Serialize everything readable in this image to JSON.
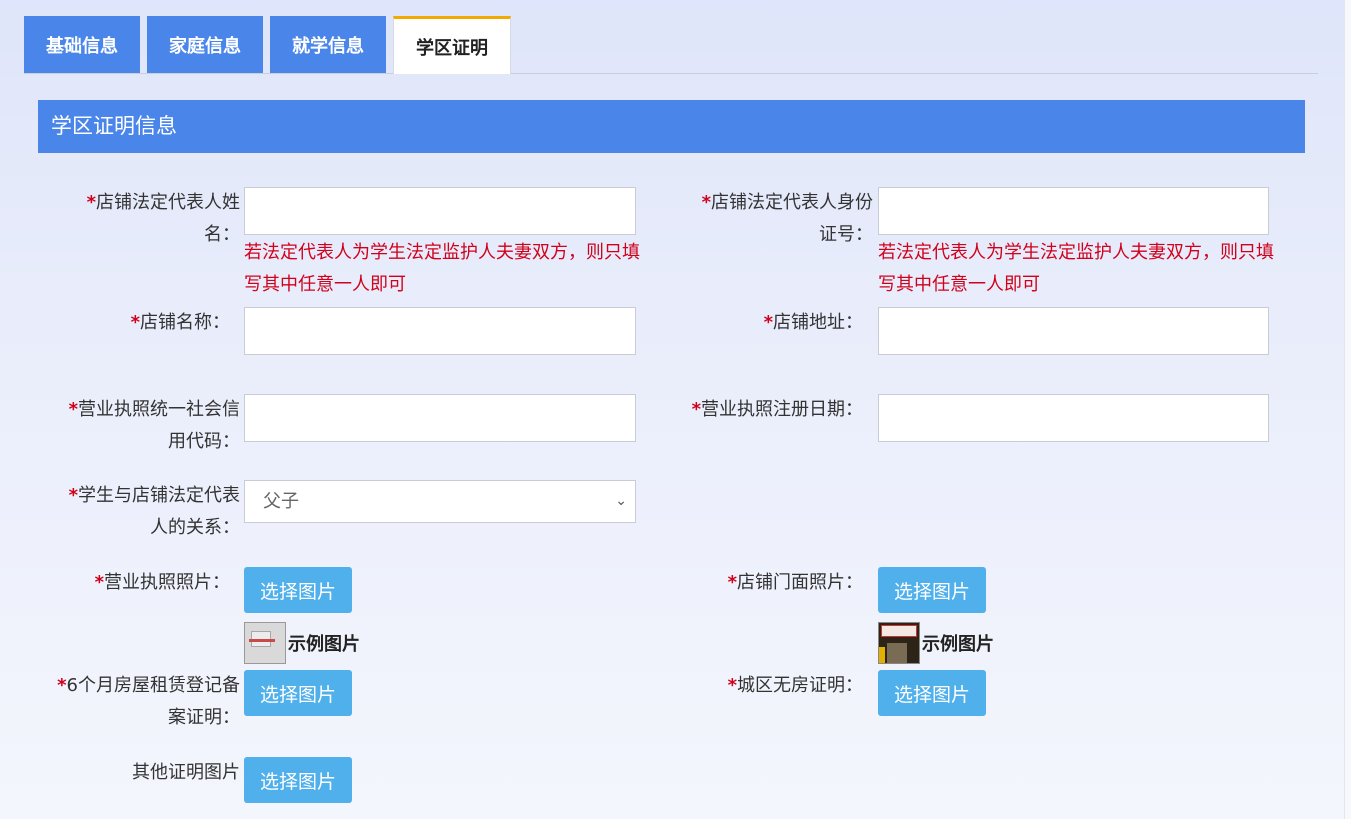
{
  "tabs": [
    {
      "label": "基础信息",
      "active": false
    },
    {
      "label": "家庭信息",
      "active": false
    },
    {
      "label": "就学信息",
      "active": false
    },
    {
      "label": "学区证明",
      "active": true
    }
  ],
  "section": {
    "title": "学区证明信息"
  },
  "form": {
    "required_mark": "*",
    "rep_name": {
      "label_l1": "店铺法定代表人姓",
      "label_l2": "名：",
      "value": ""
    },
    "rep_id": {
      "label_l1": "店铺法定代表人身份",
      "label_l2": "证号：",
      "value": ""
    },
    "hint_l1": "若法定代表人为学生法定监护人夫妻双方，则只填",
    "hint_l2": "写其中任意一人即可",
    "shop_name": {
      "label": "店铺名称：",
      "value": ""
    },
    "shop_address": {
      "label": "店铺地址：",
      "value": ""
    },
    "credit_code": {
      "label_l1": "营业执照统一社会信",
      "label_l2": "用代码：",
      "value": ""
    },
    "reg_date": {
      "label": "营业执照注册日期：",
      "value": ""
    },
    "relation": {
      "label_l1": "学生与店铺法定代表",
      "label_l2": "人的关系：",
      "selected": "父子"
    },
    "license_photo": {
      "label": "营业执照照片："
    },
    "storefront_photo": {
      "label": "店铺门面照片："
    },
    "rental_cert": {
      "label_l1": "6个月房屋租赁登记备",
      "label_l2": "案证明："
    },
    "no_house_cert": {
      "label": "城区无房证明："
    },
    "other_cert": {
      "label": "其他证明图片"
    },
    "choose_image": "选择图片",
    "example_image": "示例图片"
  },
  "colors": {
    "accent": "#4a86ea",
    "button": "#4fb0ec",
    "required": "#d0021b",
    "active_tab_border": "#f2a900"
  }
}
